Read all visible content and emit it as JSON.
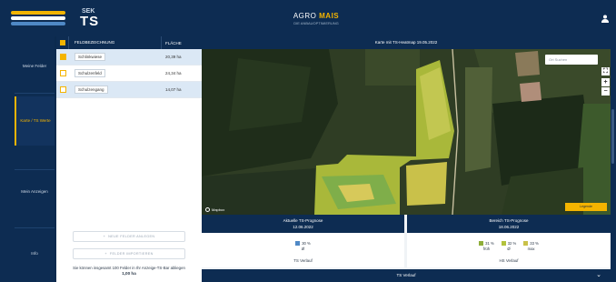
{
  "header": {
    "logo_sub": "SEK",
    "logo_main": "TS",
    "brand_prefix": "AGRO",
    "brand_suffix": "MAIS",
    "brand_tagline": "DIE ANBAUOPTIMIERUNG"
  },
  "sidebar": {
    "items": [
      {
        "label": "Meine Felder"
      },
      {
        "label": "Karte / TS Werte"
      },
      {
        "label": "Mein Anzeigen"
      },
      {
        "label": "Info"
      }
    ]
  },
  "fields": {
    "col_name": "FELDBEZEICHNUNG",
    "col_area": "FLÄCHE",
    "rows": [
      {
        "name": "Schlinkwiese",
        "area": "20,39 ha",
        "checked": true
      },
      {
        "name": "Schulzenfeld",
        "area": "24,34 ha",
        "checked": false
      },
      {
        "name": "Schulzengang",
        "area": "14,07 ha",
        "checked": false
      }
    ],
    "btn_primary": "NEUE FELDER ANLEGEN",
    "btn_secondary": "FELDER IMPORTIEREN",
    "note_text": "Sie können insgesamt 100 Felder in Ihr Anzeige-TS-Bar abliegen",
    "note_total": "1,00 ha"
  },
  "map": {
    "title": "Karte mit TS-Heatmap 19.05.2022",
    "search_placeholder": "Ort Suchen",
    "zoom_in": "+",
    "zoom_out": "−",
    "legend_button": "Legende",
    "attribution": "Mapbox"
  },
  "cards": {
    "current": {
      "title": "Aktuelle TS-Prognose",
      "date": "12.06.2022",
      "stats": [
        {
          "value": "30 %",
          "sub": "Ø",
          "color": "#4f89c6"
        }
      ],
      "footer": "TS Verlauf"
    },
    "harvest": {
      "title": "Bereich TS-Prognose",
      "date": "18.06.2022",
      "stats": [
        {
          "value": "31 %",
          "sub": "früh",
          "color": "#8fae3a"
        },
        {
          "value": "32 %",
          "sub": "Ø",
          "color": "#b2c23c"
        },
        {
          "value": "33 %",
          "sub": "max",
          "color": "#c9c14a"
        }
      ],
      "footer": "HS Verlauf"
    }
  },
  "bottom_bar": {
    "label": "TS Verlauf"
  },
  "colors": {
    "navy": "#0d2c52",
    "accent": "#f4b400",
    "selected_row": "#dbe8f5"
  }
}
